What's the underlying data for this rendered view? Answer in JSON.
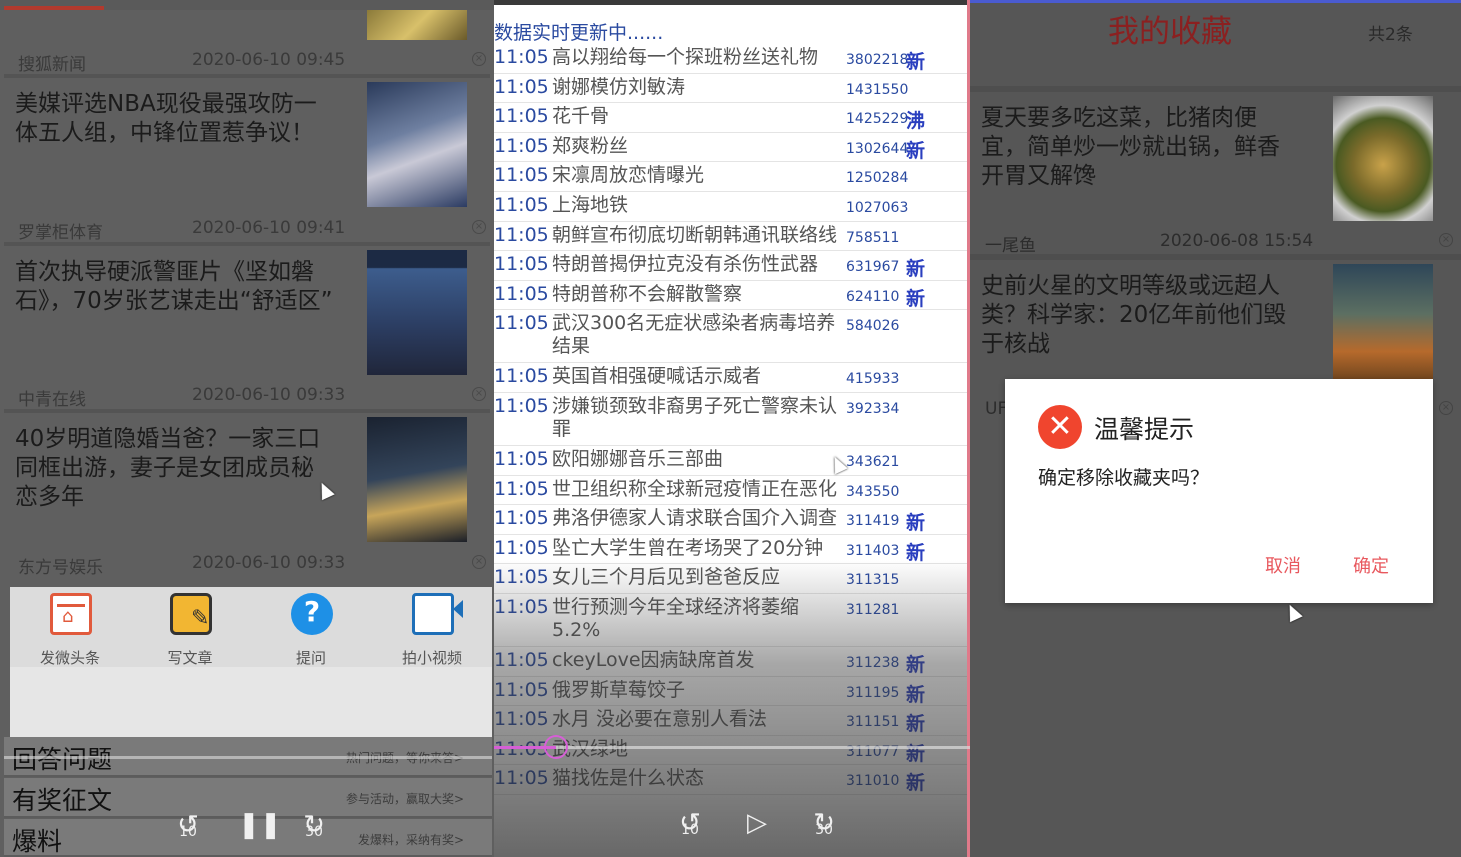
{
  "left": {
    "news_meta": [
      {
        "source": "搜狐新闻",
        "time": "2020-06-10 09:45"
      },
      {
        "source": "罗掌柜体育",
        "time": "2020-06-10 09:41"
      },
      {
        "source": "中青在线",
        "time": "2020-06-10 09:33"
      },
      {
        "source": "东方号娱乐",
        "time": "2020-06-10 09:33"
      }
    ],
    "news": [
      {
        "title": "美媒评选NBA现役最强攻防一体五人组，中锋位置惹争议！"
      },
      {
        "title": "首次执导硬派警匪片《坚如磐石》，70岁张艺谋走出“舒适区”"
      },
      {
        "title": "40岁明道隐婚当爸？一家三口同框出游，妻子是女团成员秘恋多年"
      }
    ],
    "actions": [
      {
        "label": "发微头条",
        "icon": "calendar-post-icon"
      },
      {
        "label": "写文章",
        "icon": "write-article-icon"
      },
      {
        "label": "提问",
        "icon": "question-icon"
      },
      {
        "label": "拍小视频",
        "icon": "video-camera-icon"
      }
    ],
    "list": [
      {
        "name": "回答问题",
        "hint": "热门问题，等你来答>"
      },
      {
        "name": "有奖征文",
        "hint": "参与活动，赢取大奖>"
      },
      {
        "name": "爆料",
        "hint": "发爆料，采纳有奖>"
      }
    ],
    "controls": {
      "rewind": "10",
      "forward": "30"
    }
  },
  "middle": {
    "header": "数据实时更新中......",
    "rows": [
      {
        "time": "11:05",
        "title": "高以翔给每一个探班粉丝送礼物",
        "count": "3802218",
        "badge": "新"
      },
      {
        "time": "11:05",
        "title": "谢娜模仿刘敏涛",
        "count": "1431550",
        "badge": ""
      },
      {
        "time": "11:05",
        "title": "花千骨",
        "count": "1425229",
        "badge": "沸"
      },
      {
        "time": "11:05",
        "title": "郑爽粉丝",
        "count": "1302644",
        "badge": "新"
      },
      {
        "time": "11:05",
        "title": "宋凛周放恋情曝光",
        "count": "1250284",
        "badge": ""
      },
      {
        "time": "11:05",
        "title": "上海地铁",
        "count": "1027063",
        "badge": ""
      },
      {
        "time": "11:05",
        "title": "朝鲜宣布彻底切断朝韩通讯联络线",
        "count": "758511",
        "badge": ""
      },
      {
        "time": "11:05",
        "title": "特朗普揭伊拉克没有杀伤性武器",
        "count": "631967",
        "badge": "新"
      },
      {
        "time": "11:05",
        "title": "特朗普称不会解散警察",
        "count": "624110",
        "badge": "新"
      },
      {
        "time": "11:05",
        "title": "武汉300名无症状感染者病毒培养结果",
        "count": "584026",
        "badge": ""
      },
      {
        "time": "11:05",
        "title": "英国首相强硬喊话示威者",
        "count": "415933",
        "badge": ""
      },
      {
        "time": "11:05",
        "title": "涉嫌锁颈致非裔男子死亡警察未认罪",
        "count": "392334",
        "badge": ""
      },
      {
        "time": "11:05",
        "title": "欧阳娜娜音乐三部曲",
        "count": "343621",
        "badge": ""
      },
      {
        "time": "11:05",
        "title": "世卫组织称全球新冠疫情正在恶化",
        "count": "343550",
        "badge": ""
      },
      {
        "time": "11:05",
        "title": "弗洛伊德家人请求联合国介入调查",
        "count": "311419",
        "badge": "新"
      },
      {
        "time": "11:05",
        "title": "坠亡大学生曾在考场哭了20分钟",
        "count": "311403",
        "badge": "新"
      },
      {
        "time": "11:05",
        "title": "女儿三个月后见到爸爸反应",
        "count": "311315",
        "badge": ""
      },
      {
        "time": "11:05",
        "title": "世行预测今年全球经济将萎缩5.2%",
        "count": "311281",
        "badge": ""
      },
      {
        "time": "11:05",
        "title": "ckeyLove因病缺席首发",
        "count": "311238",
        "badge": "新"
      },
      {
        "time": "11:05",
        "title": "俄罗斯草莓饺子",
        "count": "311195",
        "badge": "新"
      },
      {
        "time": "11:05",
        "title": "水月 没必要在意别人看法",
        "count": "311151",
        "badge": "新"
      },
      {
        "time": "11:05",
        "title": "武汉绿地",
        "count": "311077",
        "badge": "新"
      },
      {
        "time": "11:05",
        "title": "猫找佐是什么状态",
        "count": "311010",
        "badge": "新"
      }
    ],
    "controls": {
      "rewind": "10",
      "forward": "30"
    }
  },
  "right": {
    "title": "我的收藏",
    "count": "共2条",
    "items": [
      {
        "title": "夏天要多吃这菜，比猪肉便宜，简单炒一炒就出锅，鲜香开胃又解馋",
        "source": "一尾鱼",
        "time": "2020-06-08 15:54"
      },
      {
        "title": "史前火星的文明等级或远超人类？科学家：20亿年前他们毁于核战",
        "source": "UF",
        "time": ""
      }
    ],
    "dialog": {
      "title": "温馨提示",
      "message": "确定移除收藏夹吗？",
      "cancel": "取消",
      "confirm": "确定",
      "icon": "close-icon"
    }
  }
}
